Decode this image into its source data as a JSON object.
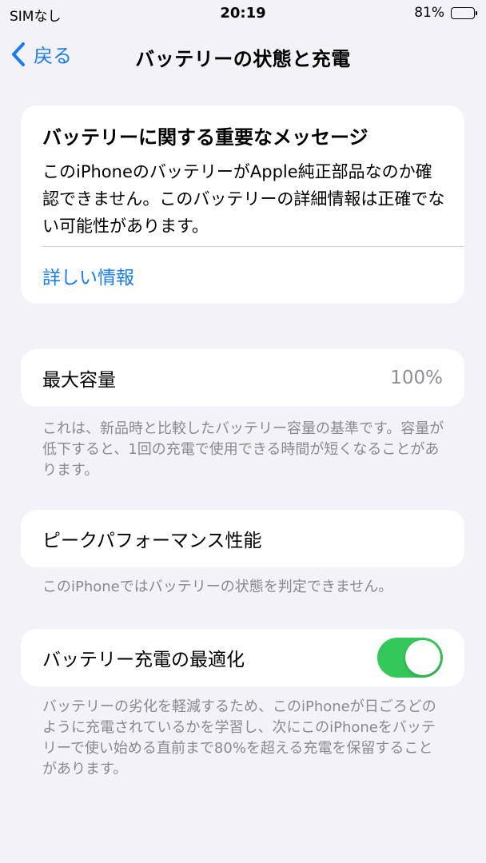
{
  "status_bar": {
    "carrier": "SIMなし",
    "time": "20:19",
    "battery_percent": "81%",
    "battery_level": 0.81
  },
  "nav": {
    "back_label": "戻る",
    "title": "バッテリーの状態と充電"
  },
  "message_card": {
    "title": "バッテリーに関する重要なメッセージ",
    "body": "このiPhoneのバッテリーがApple純正部品なのか確認できません。このバッテリーの詳細情報は正確でない可能性があります。",
    "link": "詳しい情報"
  },
  "capacity": {
    "label": "最大容量",
    "value": "100%",
    "footnote": "これは、新品時と比較したバッテリー容量の基準です。容量が低下すると、1回の充電で使用できる時間が短くなることがあります。"
  },
  "peak": {
    "label": "ピークパフォーマンス性能",
    "footnote": "このiPhoneではバッテリーの状態を判定できません。"
  },
  "optimize": {
    "label": "バッテリー充電の最適化",
    "toggle_on": true,
    "toggle_color": "#34c759",
    "footnote": "バッテリーの劣化を軽減するため、このiPhoneが日ごろどのように充電されているかを学習し、次にこのiPhoneをバッテリーで使い始める直前まで80%を超える充電を保留することがあります。"
  },
  "colors": {
    "accent": "#1a7cf5",
    "background": "#f2f2f7",
    "secondary_text": "#8a8a8e"
  }
}
